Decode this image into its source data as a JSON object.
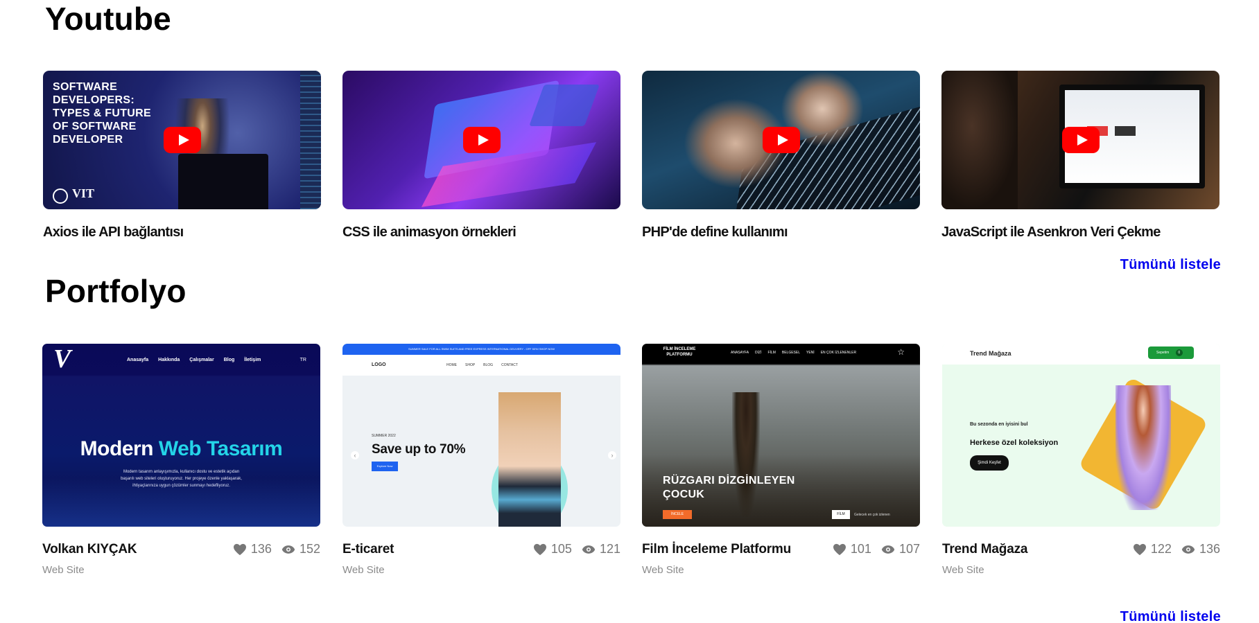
{
  "youtube": {
    "title": "Youtube",
    "list_all": "Tümünü listele",
    "videos": [
      {
        "caption": "Axios ile API bağlantısı",
        "thumb_text": "SOFTWARE DEVELOPERS: TYPES & FUTURE OF SOFTWARE DEVELOPER",
        "thumb_logo": "VIT"
      },
      {
        "caption": "CSS ile animasyon örnekleri"
      },
      {
        "caption": "PHP'de define kullanımı"
      },
      {
        "caption": "JavaScript ile Asenkron Veri Çekme"
      }
    ]
  },
  "portfolio": {
    "title": "Portfolyo",
    "list_all": "Tümünü listele",
    "items": [
      {
        "name": "Volkan KIYÇAK",
        "category": "Web Site",
        "likes": "136",
        "views": "152",
        "shot": {
          "logo": "V",
          "nav": [
            "Anasayfa",
            "Hakkında",
            "Çalışmalar",
            "Blog",
            "İletişim"
          ],
          "lang": "TR",
          "hero_a": "Modern ",
          "hero_b": "Web Tasarım",
          "desc": "Modern tasarım anlayışımızla, kullanıcı dostu ve estetik açıdan başarılı web siteleri oluşturuyoruz. Her projeye özenle yaklaşarak, ihtiyaçlarınıza uygun çözümler sunmayı hedefliyoruz."
        }
      },
      {
        "name": "E-ticaret",
        "category": "Web Site",
        "likes": "105",
        "views": "121",
        "shot": {
          "topbar": "SUMMER SALE FOR ALL SWIM SUITS AND FREE EXPRESS INTERNATIONAL DELIVERY - OFF 50%! SHOP NOW",
          "logo": "LOGO",
          "nav": [
            "HOME",
            "SHOP",
            "BLOG",
            "CONTACT"
          ],
          "kicker": "SUMMER 2022",
          "headline": "Save up to 70%",
          "cta": "Explore Now"
        }
      },
      {
        "name": "Film İnceleme Platformu",
        "category": "Web Site",
        "likes": "101",
        "views": "107",
        "shot": {
          "logo": "FİLM İNCELEME PLATFORMU",
          "nav": [
            "ANASAYFA",
            "DİZİ",
            "FİLM",
            "BELGESEL",
            "YENİ",
            "EN ÇOK İZLENENLER"
          ],
          "hero": "RÜZGARI DİZGİNLEYEN ÇOCUK",
          "button": "İNCELE",
          "tag": "FİLM",
          "tag_note": "Gelecek en çok izlenen"
        }
      },
      {
        "name": "Trend Mağaza",
        "category": "Web Site",
        "likes": "122",
        "views": "136",
        "shot": {
          "logo": "Trend Mağaza",
          "cart": "Sepetim",
          "cart_count": "0",
          "kicker": "Bu sezonda en iyisini bul",
          "headline": "Herkese özel koleksiyon",
          "cta": "Şimdi Keşfet"
        }
      }
    ]
  },
  "colors": {
    "link": "#0000ee",
    "youtube_red": "#ff0000",
    "meta_gray": "#8a8a8a"
  },
  "icons": {
    "like": "heart-icon",
    "views": "eye-icon",
    "play": "play-icon"
  }
}
